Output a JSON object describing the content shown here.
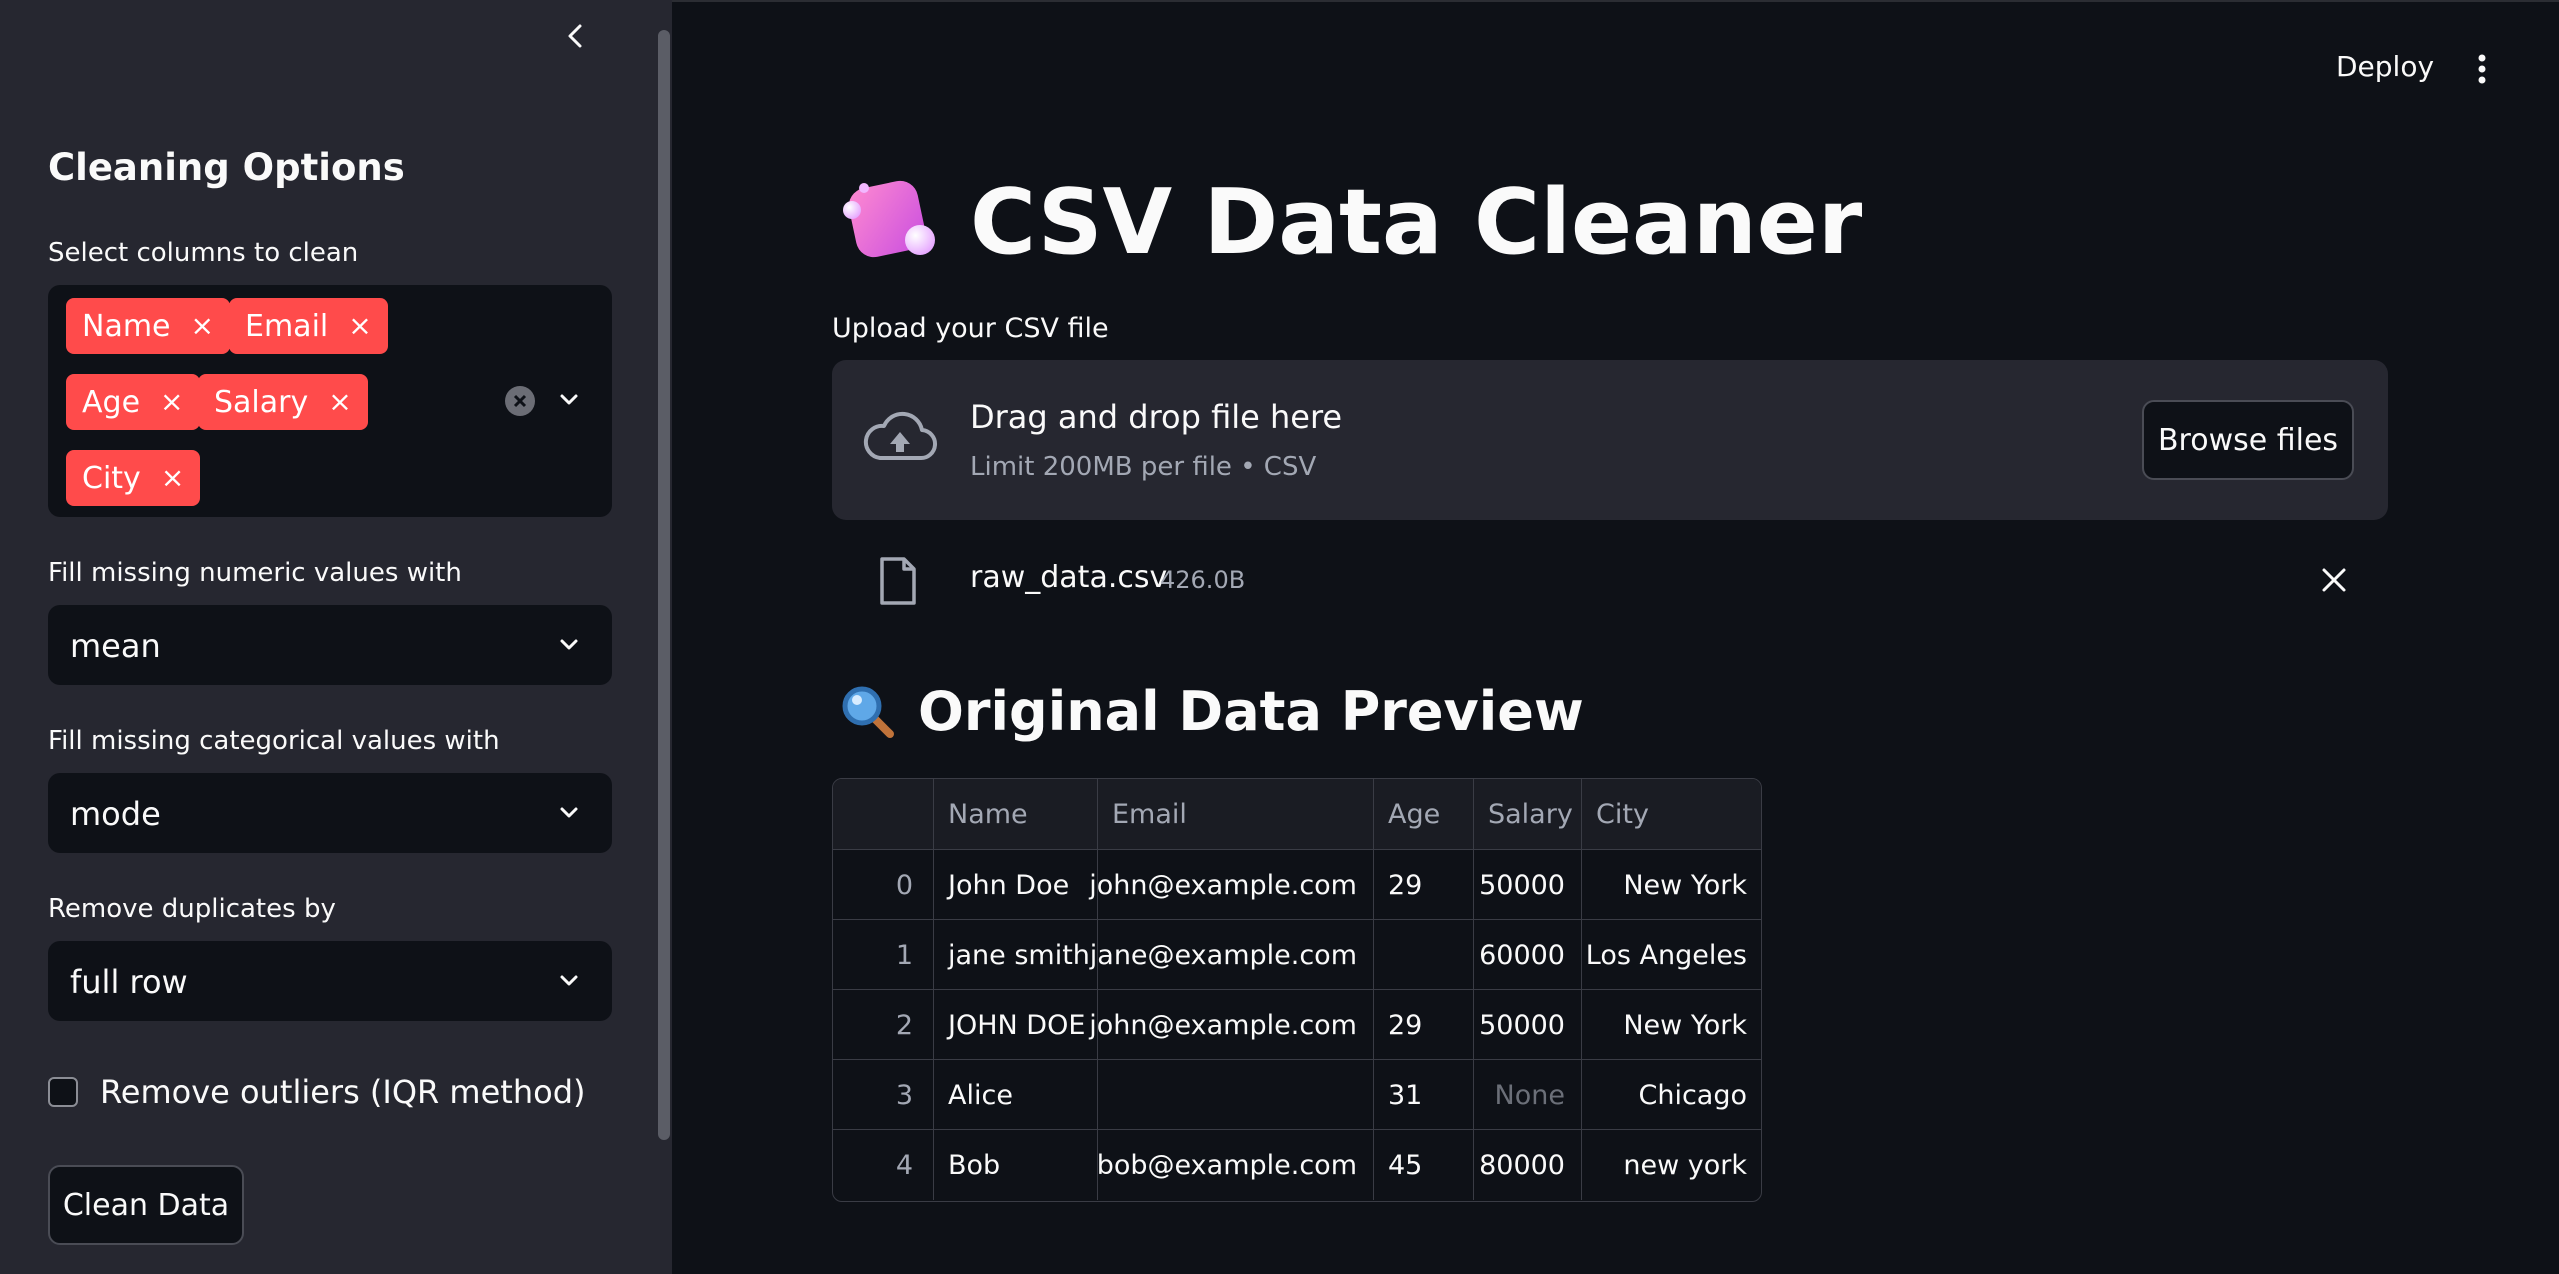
{
  "sidebar": {
    "title": "Cleaning Options",
    "columns_label": "Select columns to clean",
    "columns_selected": [
      "Name",
      "Email",
      "Age",
      "Salary",
      "City"
    ],
    "numeric_fill_label": "Fill missing numeric values with",
    "numeric_fill_value": "mean",
    "categorical_fill_label": "Fill missing categorical values with",
    "categorical_fill_value": "mode",
    "dedupe_label": "Remove duplicates by",
    "dedupe_value": "full row",
    "outliers_label": "Remove outliers (IQR method)",
    "outliers_checked": false,
    "clean_button": "Clean Data"
  },
  "header": {
    "deploy_label": "Deploy",
    "menu_icon": "kebab-menu-icon"
  },
  "main": {
    "title": "CSV Data Cleaner",
    "title_icon": "bubbles-cube-icon",
    "upload_label": "Upload your CSV file",
    "dropzone_text": "Drag and drop file here",
    "dropzone_limit": "Limit 200MB per file • CSV",
    "browse_button": "Browse files",
    "file_name": "raw_data.csv",
    "file_size": "426.0B",
    "preview_title": "Original Data Preview",
    "preview_icon": "magnifier-icon",
    "table": {
      "columns": [
        "",
        "Name",
        "Email",
        "Age",
        "Salary",
        "City"
      ],
      "rows": [
        [
          "0",
          "John Doe",
          "john@example.com",
          "29",
          "50000",
          "New York"
        ],
        [
          "1",
          "jane smith",
          "jane@example.com",
          "",
          "60000",
          "Los Angeles"
        ],
        [
          "2",
          "JOHN DOE",
          "john@example.com",
          "29",
          "50000",
          "New York"
        ],
        [
          "3",
          "Alice",
          "",
          "31",
          "None",
          "Chicago"
        ],
        [
          "4",
          "Bob",
          "bob@example.com",
          "45",
          "80000",
          "new york"
        ]
      ]
    }
  },
  "colors": {
    "accent": "#ff4b4b",
    "background": "#0e1117",
    "sidebar": "#262730",
    "text": "#fafafa",
    "muted": "#a3a8b4"
  }
}
